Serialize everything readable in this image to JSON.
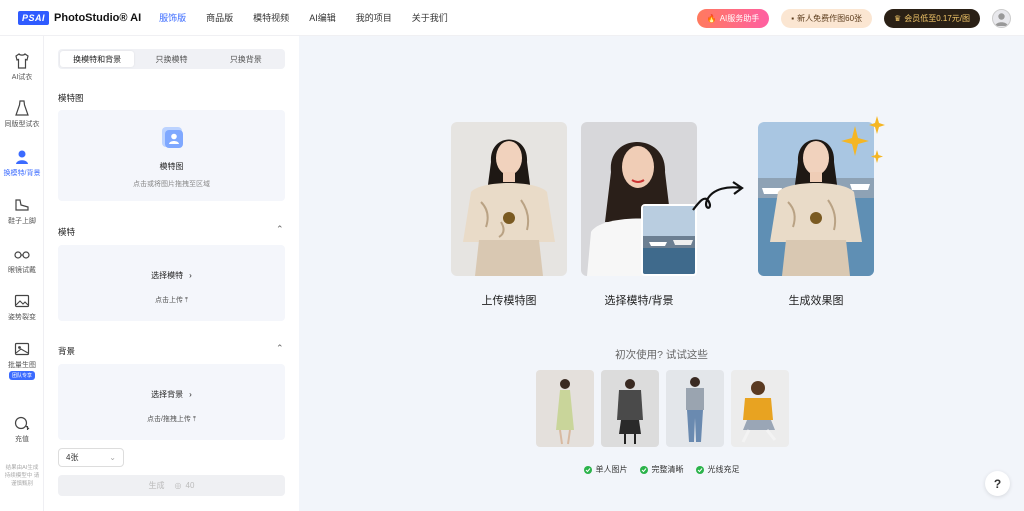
{
  "brand": {
    "logo_badge": "PSAI",
    "name": "PhotoStudio® AI"
  },
  "nav": [
    "服饰版",
    "商品版",
    "模特视频",
    "AI编辑",
    "我的项目",
    "关于我们"
  ],
  "top_actions": {
    "ai_assistant": "AI服务助手",
    "new_user": "新人免费作图60张",
    "vip": "会员低至0.17元/图"
  },
  "rail": {
    "items": [
      "AI试衣",
      "同版型试衣",
      "换模特/背景",
      "鞋子上脚",
      "眼镜试戴",
      "姿势裂变",
      "批量生图",
      "充值"
    ],
    "batch_tag": "团队专享",
    "footer": "结果由AI生成 持续模型中 请谨慎甄别"
  },
  "tabs": [
    "换模特和背景",
    "只换模特",
    "只换背景"
  ],
  "model_image": {
    "label": "模特图",
    "title": "模特图",
    "hint": "点击或将图片拖拽至区域"
  },
  "model_section": {
    "label": "模特",
    "select": "选择模特",
    "upload": "点击上传"
  },
  "background_section": {
    "label": "背景",
    "select": "选择背景",
    "upload": "点击/拖拽上传"
  },
  "count_select": "4张",
  "generate": {
    "label": "生成",
    "cost": "40"
  },
  "steps": [
    "上传模特图",
    "选择模特/背景",
    "生成效果图"
  ],
  "try_title": "初次使用? 试试这些",
  "features": [
    "单人图片",
    "完整清晰",
    "光线充足"
  ],
  "help": "?",
  "colors": {
    "accent": "#3b6bff",
    "check": "#2bb34a",
    "main_bg": "#f2f5fa"
  }
}
